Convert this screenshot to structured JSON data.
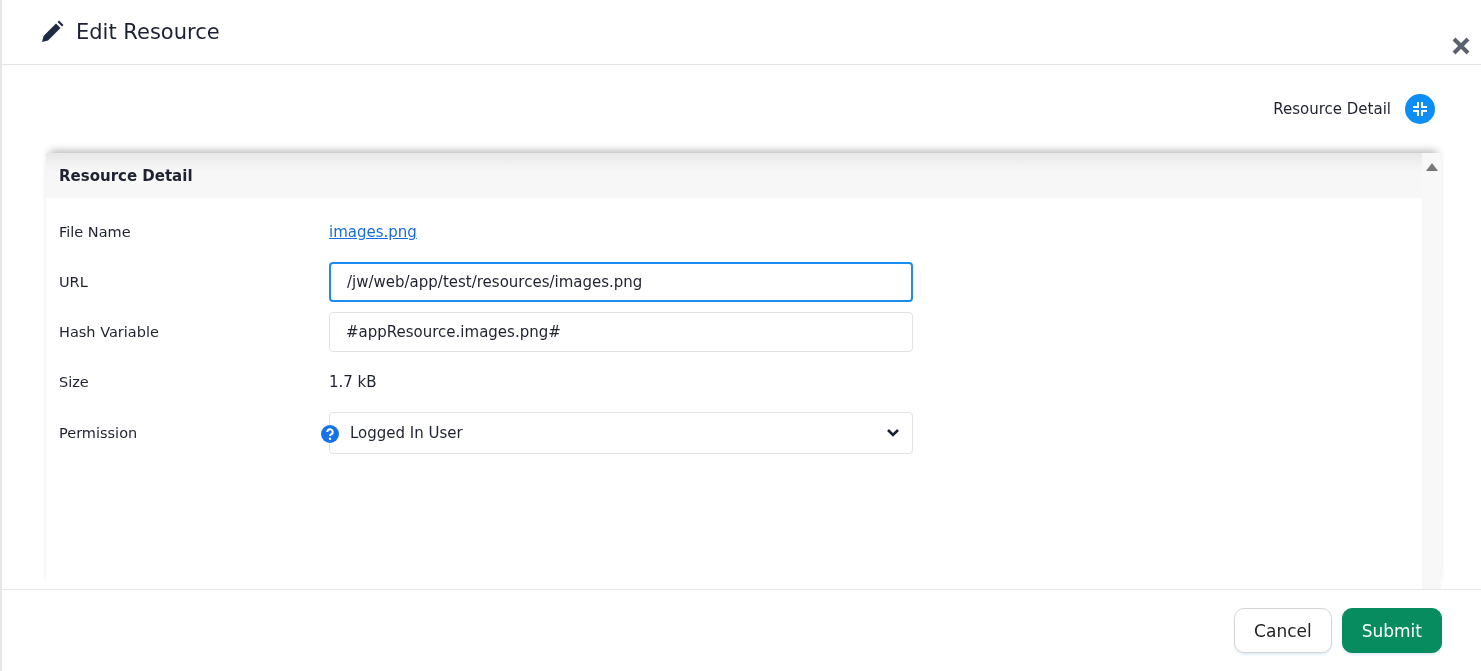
{
  "dialog": {
    "title": "Edit Resource"
  },
  "section_nav": {
    "label": "Resource Detail"
  },
  "panel": {
    "title": "Resource Detail"
  },
  "fields": [
    {
      "kind": "link",
      "label": "File Name",
      "value": "images.png"
    },
    {
      "kind": "input",
      "label": "URL",
      "value": "/jw/web/app/test/resources/images.png",
      "focused": true
    },
    {
      "kind": "input",
      "label": "Hash Variable",
      "value": "#appResource.images.png#",
      "focused": false
    },
    {
      "kind": "text",
      "label": "Size",
      "value": "1.7 kB"
    },
    {
      "kind": "select",
      "label": "Permission",
      "value": "Logged In User",
      "help": true
    }
  ],
  "buttons": [
    {
      "label": "Cancel",
      "kind": "secondary"
    },
    {
      "label": "Submit",
      "kind": "primary"
    }
  ]
}
